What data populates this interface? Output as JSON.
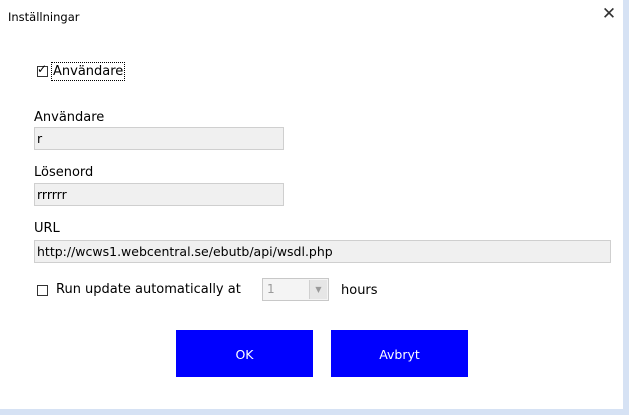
{
  "window": {
    "title": "Inställningar",
    "close_glyph": "✕"
  },
  "user_toggle": {
    "label": "Användare",
    "checked": true,
    "tick": "✓"
  },
  "fields": {
    "username": {
      "label": "Användare",
      "value": "r"
    },
    "password": {
      "label": "Lösenord",
      "value": "rrrrrr"
    },
    "url": {
      "label": "URL",
      "value": "http://wcws1.webcentral.se/ebutb/api/wsdl.php"
    }
  },
  "auto_update": {
    "label": "Run update automatically at",
    "checked": false,
    "interval_value": "1",
    "unit_label": "hours",
    "arrow_glyph": "▼"
  },
  "buttons": {
    "ok_label": "OK",
    "cancel_label": "Avbryt",
    "color": "#0000ff"
  }
}
